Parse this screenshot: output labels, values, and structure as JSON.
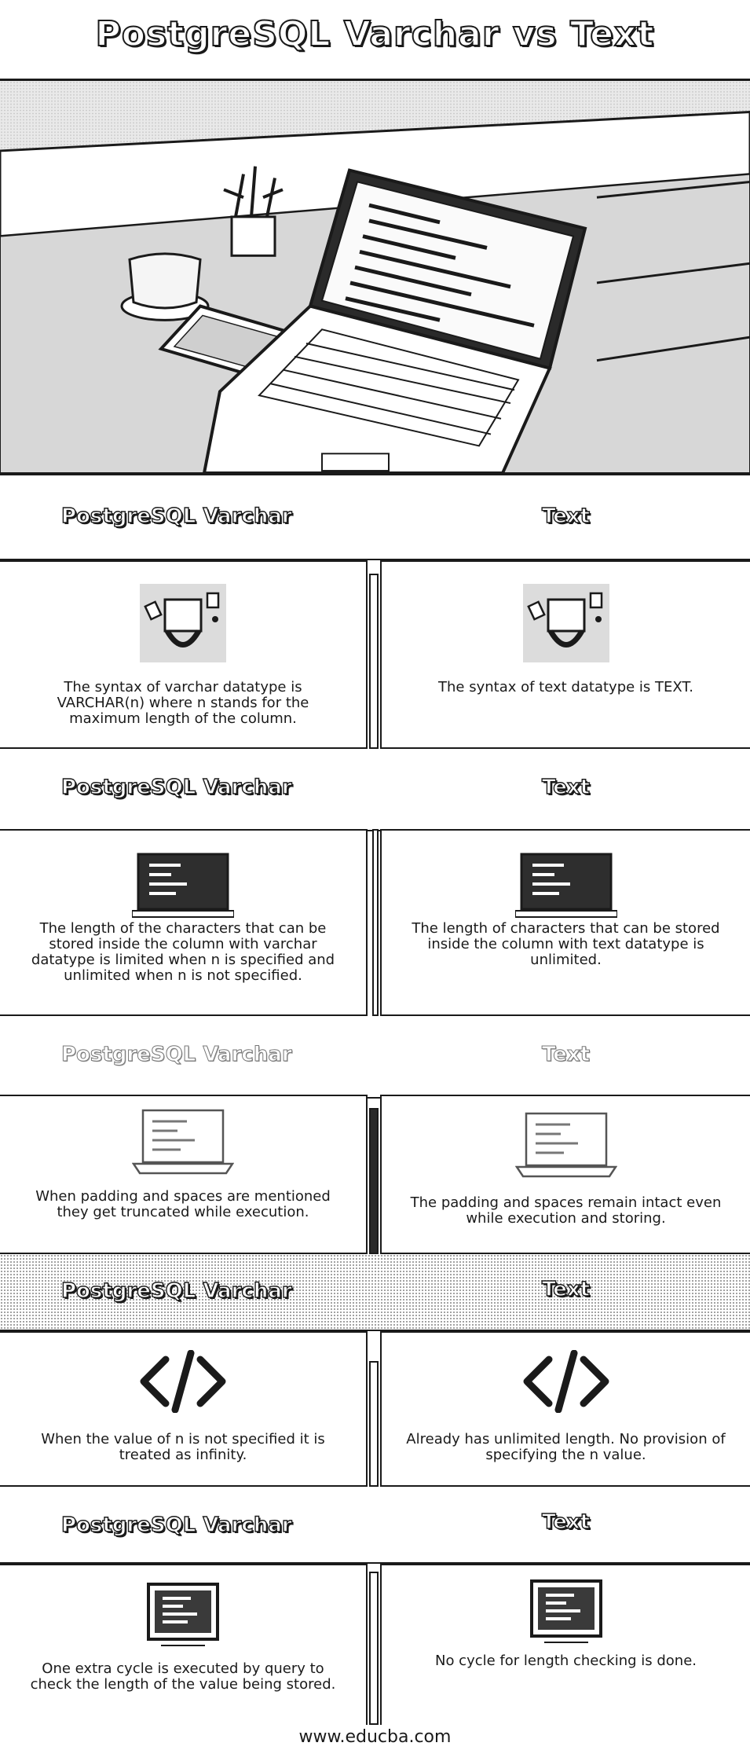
{
  "title": "PostgreSQL Varchar vs Text",
  "header": {
    "left": "PostgreSQL Varchar",
    "right": "Text"
  },
  "rows": [
    {
      "left_icon": "plug-connector-icon",
      "right_icon": "plug-connector-icon",
      "left": "The syntax of varchar datatype is VARCHAR(n) where n stands for the maximum length of the column.",
      "right": "The syntax of text datatype is TEXT."
    },
    {
      "left_icon": "monitor-code-icon",
      "right_icon": "monitor-code-icon",
      "left": "The length of the characters that can be stored inside the column with varchar datatype is limited when n is specified and unlimited when n is not specified.",
      "right": "The length of characters that can be stored inside the column with text datatype is unlimited."
    },
    {
      "left_icon": "laptop-icon",
      "right_icon": "laptop-icon",
      "left": "When padding and spaces are mentioned they get truncated while execution.",
      "right": "The padding and spaces remain intact even while execution and storing."
    },
    {
      "left_icon": "code-tag-icon",
      "right_icon": "code-tag-icon",
      "left": "When the value of n is not specified it is treated as infinity.",
      "right": "Already has unlimited length. No provision of specifying the n value."
    },
    {
      "left_icon": "code-window-icon",
      "right_icon": "code-window-icon",
      "left": "One extra cycle is executed by query to check the length of the value being stored.",
      "right": "No cycle for length checking is done."
    }
  ],
  "footer": "www.educba.com"
}
